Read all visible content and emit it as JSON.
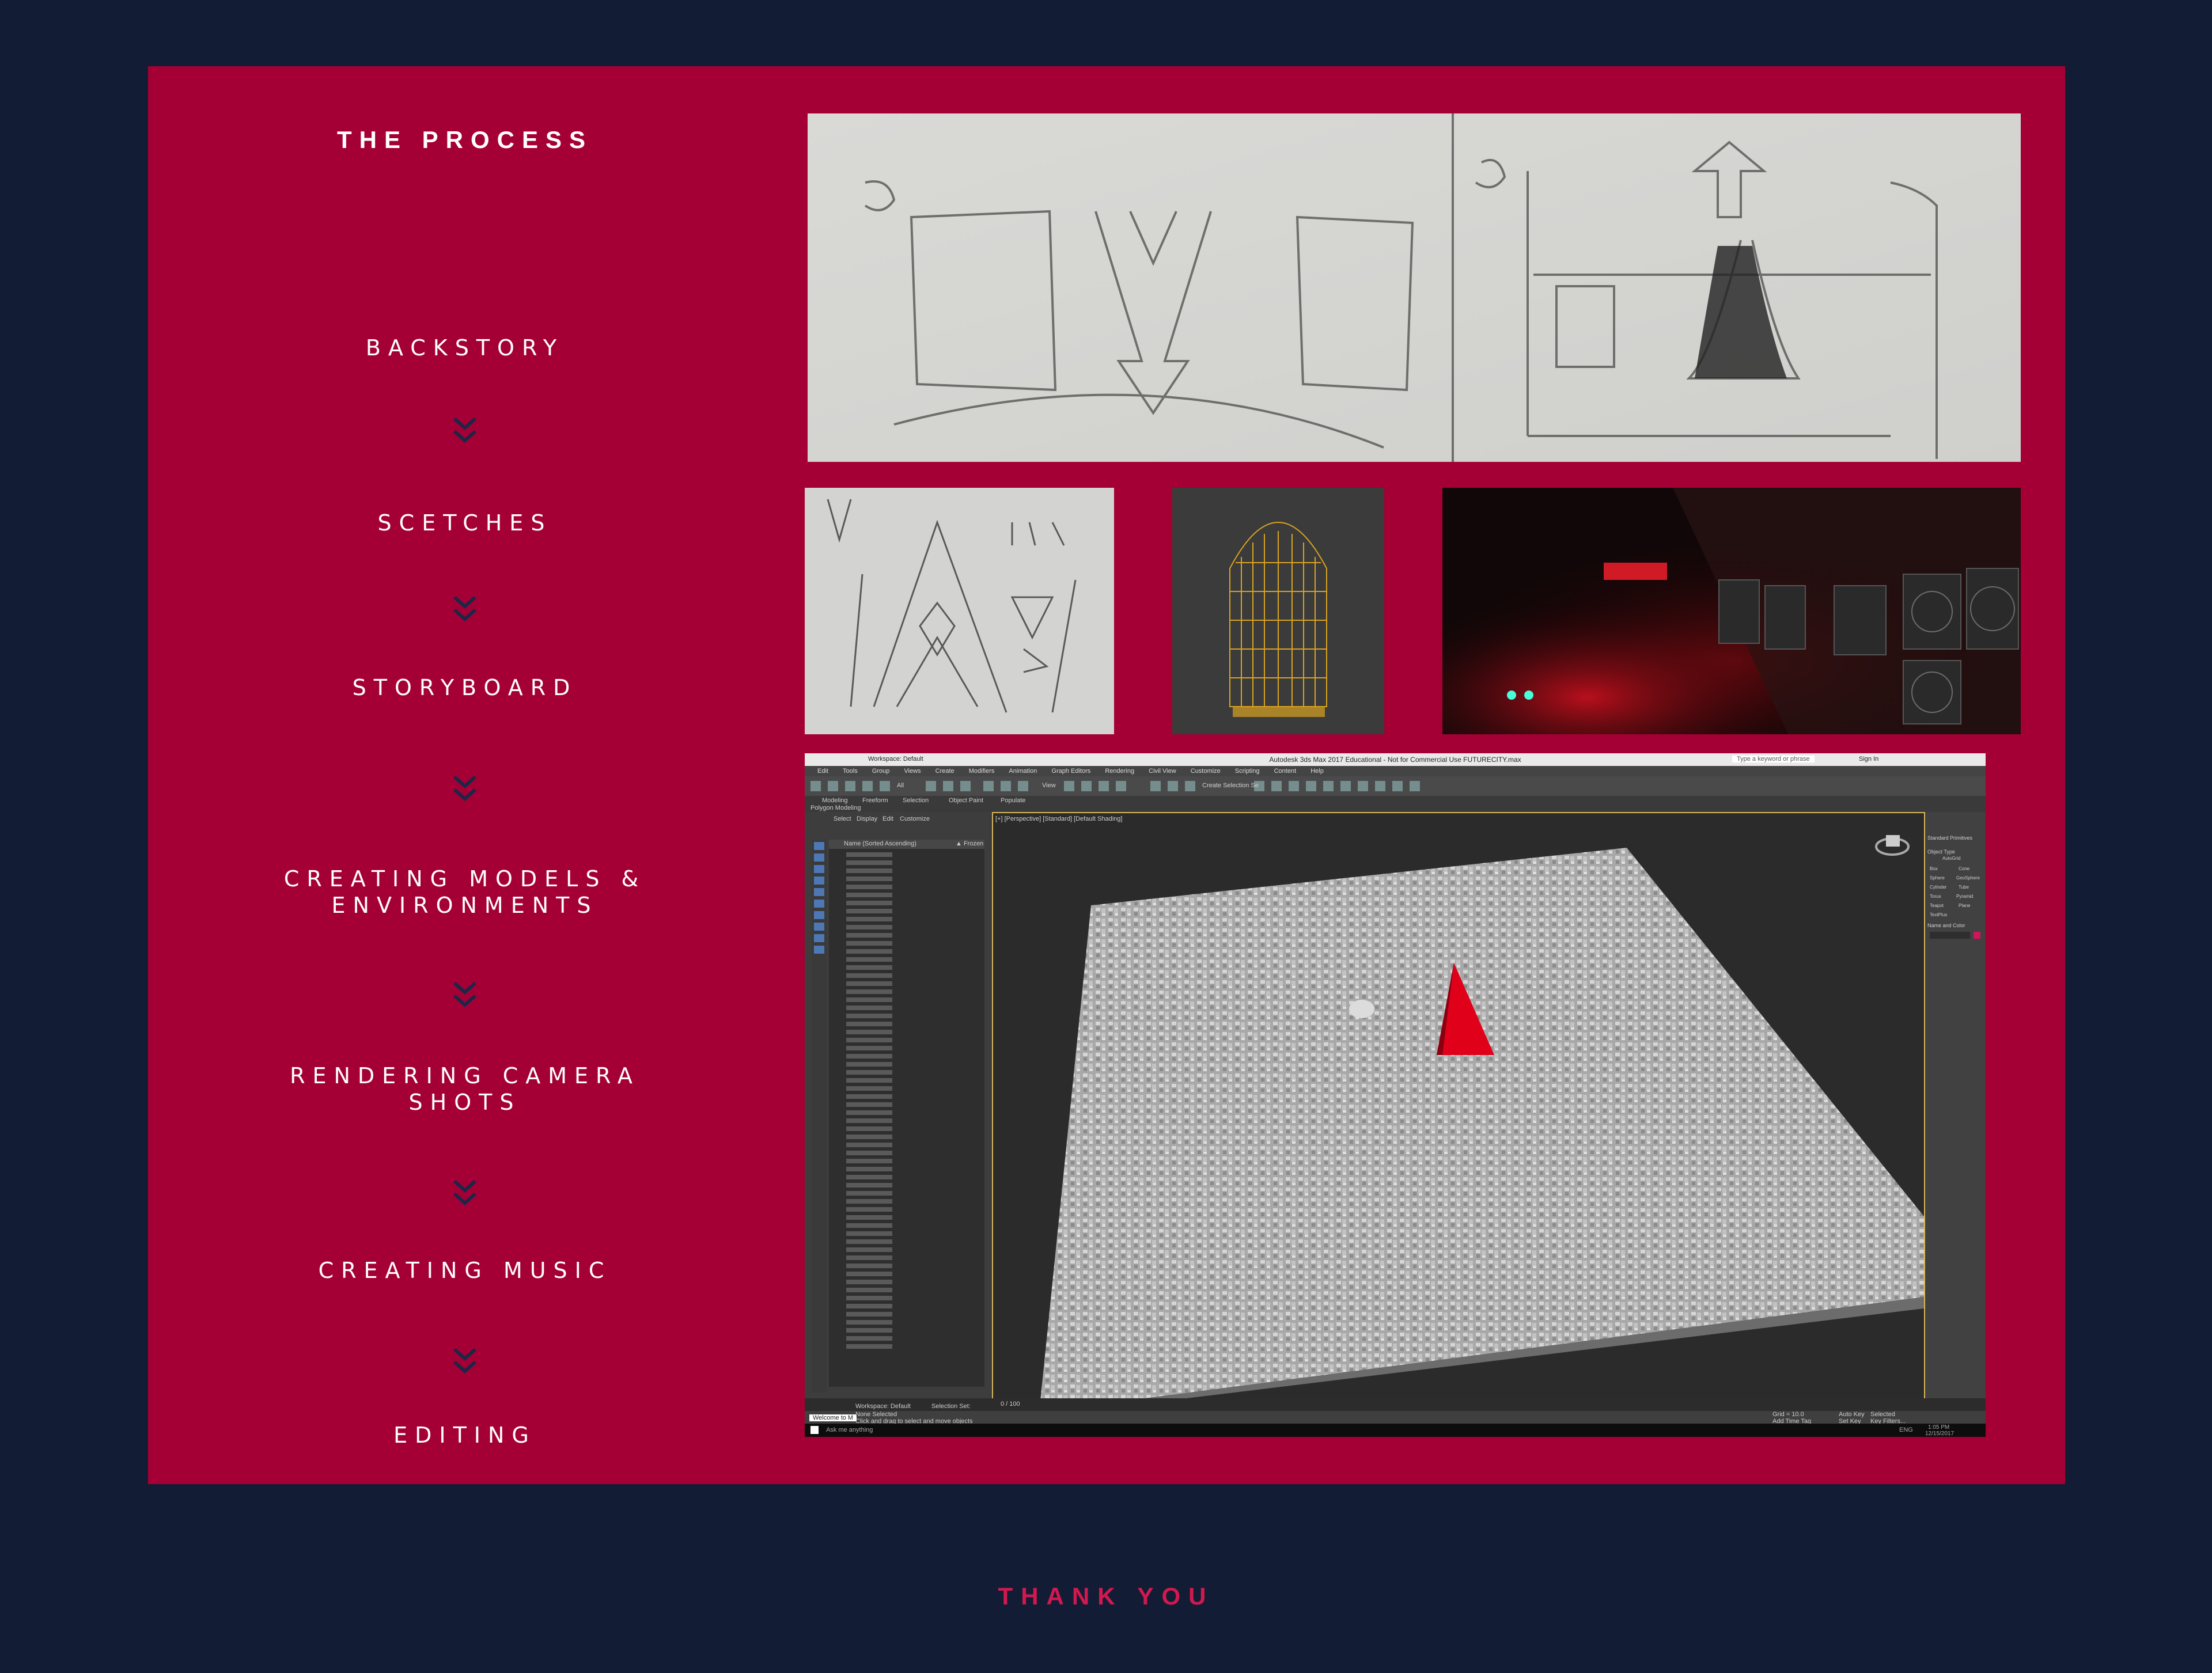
{
  "header": {
    "title": "THE PROCESS"
  },
  "steps": [
    {
      "line1": "BACKSTORY",
      "line2": ""
    },
    {
      "line1": "SCETCHES",
      "line2": ""
    },
    {
      "line1": "STORYBOARD",
      "line2": ""
    },
    {
      "line1": "CREATING MODELS &",
      "line2": "ENVIRONMENTS"
    },
    {
      "line1": "RENDERING CAMERA",
      "line2": "SHOTS"
    },
    {
      "line1": "CREATING MUSIC",
      "line2": ""
    },
    {
      "line1": "EDITING",
      "line2": ""
    }
  ],
  "footer": {
    "text": "THANK YOU"
  },
  "software": {
    "window_title": "Autodesk 3ds Max 2017 Educational - Not for Commercial Use   FUTURECITY.max",
    "workspace": "Workspace: Default",
    "search_placeholder": "Type a keyword or phrase",
    "sign_in": "Sign In",
    "menus": [
      "Edit",
      "Tools",
      "Group",
      "Views",
      "Create",
      "Modifiers",
      "Animation",
      "Graph Editors",
      "Rendering",
      "Civil View",
      "Customize",
      "Scripting",
      "Content",
      "Help"
    ],
    "ribbon_tabs": [
      "Modeling",
      "Freeform",
      "Selection",
      "Object Paint",
      "Populate"
    ],
    "ribbon_sub": "Polygon Modeling",
    "explorer_tabs": [
      "Select",
      "Display",
      "Edit",
      "Customize"
    ],
    "explorer_header": "Name (Sorted Ascending)",
    "explorer_header_right": "▲ Frozen",
    "viewport_label": "[+] [Perspective] [Standard] [Default Shading]",
    "object_type": "Object Type",
    "autogrid": "AutoGrid",
    "primitives": [
      "Box",
      "Cone",
      "Sphere",
      "GeoSphere",
      "Cylinder",
      "Tube",
      "Torus",
      "Pyramid",
      "Teapot",
      "Plane",
      "TextPlus"
    ],
    "dropdown": "Standard Primitives",
    "name_and_color": "Name and Color",
    "timeline_frame": "0 / 100",
    "status_selection": "None Selected",
    "status_hint": "Click and drag to select and move objects",
    "workspace_bottom": "Workspace: Default",
    "selection_set": "Selection Set:",
    "grid": "Grid = 10.0",
    "add_time_tag": "Add Time Tag",
    "auto_key": "Auto Key",
    "set_key": "Set Key",
    "selected": "Selected",
    "key_filters": "Key Filters...",
    "welcome": "Welcome to M",
    "taskbar_search": "Ask me anything",
    "clock_time": "1:05 PM",
    "clock_date": "12/15/2017",
    "lang": "ENG",
    "top_toolbar_view": "View",
    "top_toolbar_all": "All",
    "selection_set_btn": "Create Selection Se"
  },
  "colors": {
    "background": "#131c35",
    "panel": "#a50035",
    "thanks": "#d1194f"
  }
}
